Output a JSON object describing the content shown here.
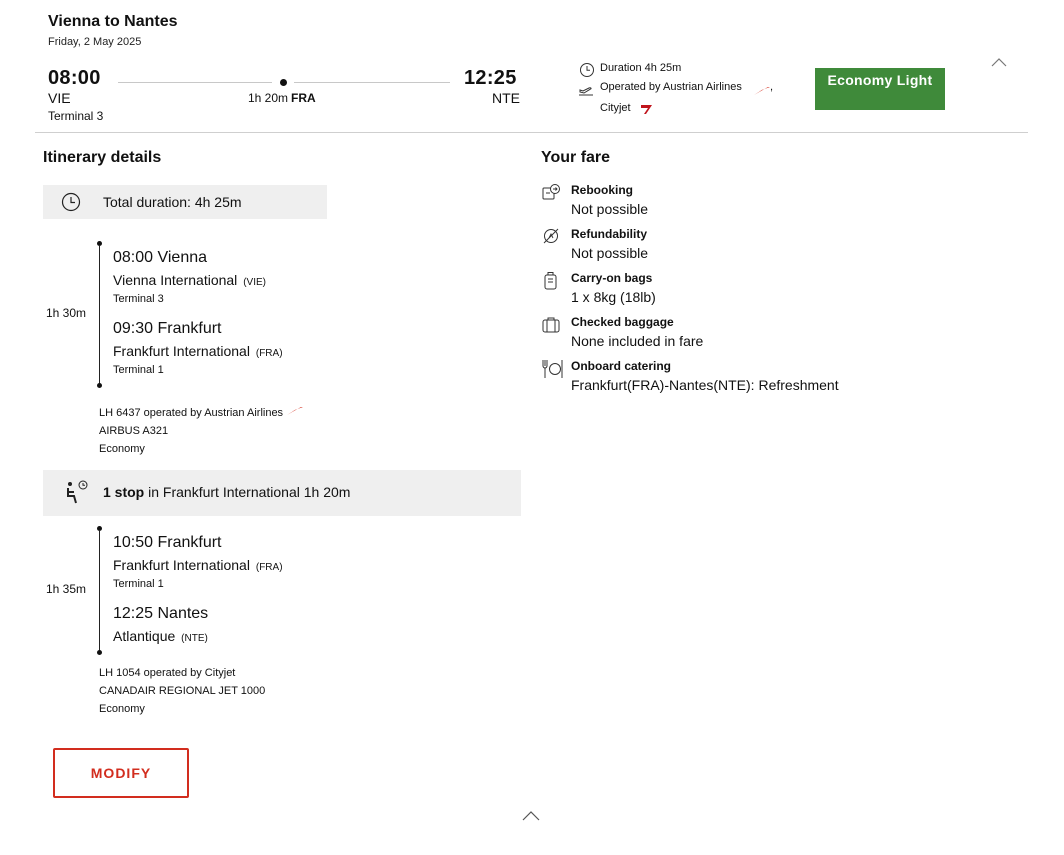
{
  "header": {
    "title": "Vienna to Nantes",
    "date": "Friday, 2 May 2025",
    "departure": {
      "time": "08:00",
      "code": "VIE",
      "terminal": "Terminal 3"
    },
    "arrival": {
      "time": "12:25",
      "code": "NTE"
    },
    "stop": {
      "duration": "1h 20m",
      "code": "FRA"
    },
    "duration": "Duration 4h 25m",
    "operated_by": "Operated by Austrian Airlines",
    "operated_comma": ",",
    "operated_by_2": "Cityjet",
    "fare_badge": "Economy Light"
  },
  "itinerary": {
    "heading": "Itinerary details",
    "total_duration": "Total duration: 4h 25m",
    "segments": [
      {
        "duration": "1h 30m",
        "dep_time_city": "08:00 Vienna",
        "dep_airport": "Vienna International",
        "dep_code": "(VIE)",
        "dep_terminal": "Terminal 3",
        "arr_time_city": "09:30 Frankfurt",
        "arr_airport": "Frankfurt International",
        "arr_code": "(FRA)",
        "arr_terminal": "Terminal 1",
        "flight": "LH 6437  operated by Austrian Airlines",
        "aircraft": "AIRBUS A321",
        "cabin": "Economy"
      },
      {
        "duration": "1h 35m",
        "dep_time_city": "10:50 Frankfurt",
        "dep_airport": "Frankfurt International",
        "dep_code": "(FRA)",
        "dep_terminal": "Terminal 1",
        "arr_time_city": "12:25 Nantes",
        "arr_airport": "Atlantique",
        "arr_code": "(NTE)",
        "flight": "LH 1054  operated by Cityjet",
        "aircraft": "CANADAIR REGIONAL JET 1000",
        "cabin": "Economy"
      }
    ],
    "stop_count": "1 stop",
    "stop_detail": "in Frankfurt International 1h 20m",
    "modify_label": "MODIFY"
  },
  "fare": {
    "heading": "Your fare",
    "items": [
      {
        "title": "Rebooking",
        "value": "Not possible",
        "icon": "rebooking-icon"
      },
      {
        "title": "Refundability",
        "value": "Not possible",
        "icon": "no-refund-icon"
      },
      {
        "title": "Carry-on bags",
        "value": "1 x 8kg (18lb)",
        "icon": "carry-on-bag-icon"
      },
      {
        "title": "Checked baggage",
        "value": "None included in fare",
        "icon": "checked-baggage-icon"
      },
      {
        "title": "Onboard catering",
        "value": "Frankfurt(FRA)-Nantes(NTE): Refreshment",
        "icon": "catering-icon"
      }
    ]
  },
  "colors": {
    "fare_badge_bg": "#3f8a3a",
    "accent_red": "#d22d1e",
    "panel_grey": "#efefef"
  }
}
